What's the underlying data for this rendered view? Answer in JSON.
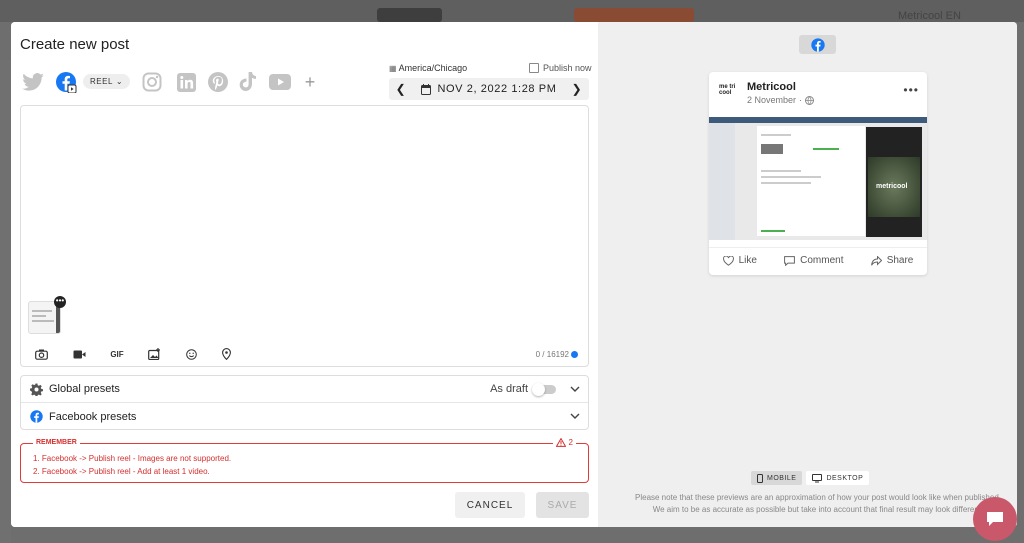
{
  "background": {
    "user_label": "Metricool EN"
  },
  "modal": {
    "title": "Create new post",
    "networks": [
      "twitter-icon",
      "facebook-icon",
      "instagram-icon",
      "linkedin-icon",
      "pinterest-icon",
      "tiktok-icon",
      "youtube-icon",
      "add-network-icon"
    ],
    "post_type": "REEL",
    "timezone": "America/Chicago",
    "publish_now": "Publish now",
    "date": "NOV 2, 2022 1:28 PM",
    "editor": {
      "tools": [
        "camera-icon",
        "video-icon",
        "gif-icon",
        "image-edit-icon",
        "emoji-icon",
        "location-icon"
      ],
      "gif_label": "GIF",
      "counter": "0 / 16192"
    },
    "presets": {
      "global": "Global presets",
      "draft_label": "As draft",
      "facebook": "Facebook presets"
    },
    "remember": {
      "title": "REMEMBER",
      "count": "2",
      "items": [
        "1. Facebook -> Publish reel - Images are not supported.",
        "2. Facebook -> Publish reel - Add at least 1 video."
      ]
    },
    "buttons": {
      "cancel": "CANCEL",
      "save": "SAVE"
    }
  },
  "preview": {
    "account_name": "Metricool",
    "logo_text": "me tri cool",
    "date": "2 November",
    "media_text": "metricool",
    "actions": {
      "like": "Like",
      "comment": "Comment",
      "share": "Share"
    },
    "view_modes": {
      "mobile": "MOBILE",
      "desktop": "DESKTOP"
    },
    "note_line1": "Please note that these previews are an approximation of how your post would look like when published.",
    "note_line2": "We aim to be as accurate as possible but take into account that final result may look different."
  },
  "colors": {
    "facebook": "#1877f2",
    "error": "#d32f2f",
    "chat": "#c8586a"
  }
}
